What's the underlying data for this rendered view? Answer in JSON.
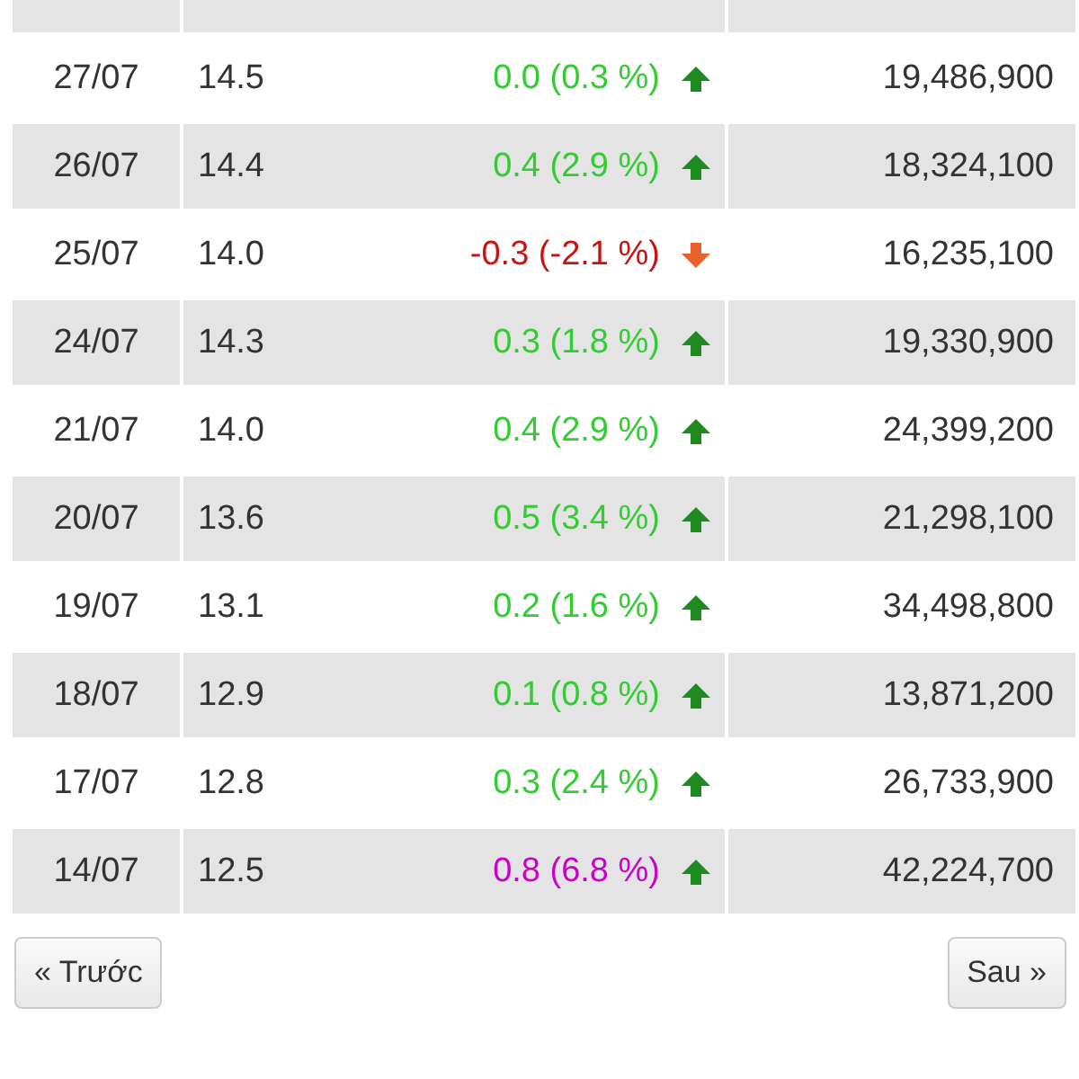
{
  "rows": [
    {
      "date": "27/07",
      "close": "14.5",
      "change": "0.0 (0.3 %)",
      "kind": "up",
      "volume": "19,486,900"
    },
    {
      "date": "26/07",
      "close": "14.4",
      "change": "0.4 (2.9 %)",
      "kind": "up",
      "volume": "18,324,100"
    },
    {
      "date": "25/07",
      "close": "14.0",
      "change": "-0.3 (-2.1 %)",
      "kind": "down",
      "volume": "16,235,100"
    },
    {
      "date": "24/07",
      "close": "14.3",
      "change": "0.3 (1.8 %)",
      "kind": "up",
      "volume": "19,330,900"
    },
    {
      "date": "21/07",
      "close": "14.0",
      "change": "0.4 (2.9 %)",
      "kind": "up",
      "volume": "24,399,200"
    },
    {
      "date": "20/07",
      "close": "13.6",
      "change": "0.5 (3.4 %)",
      "kind": "up",
      "volume": "21,298,100"
    },
    {
      "date": "19/07",
      "close": "13.1",
      "change": "0.2 (1.6 %)",
      "kind": "up",
      "volume": "34,498,800"
    },
    {
      "date": "18/07",
      "close": "12.9",
      "change": "0.1 (0.8 %)",
      "kind": "up",
      "volume": "13,871,200"
    },
    {
      "date": "17/07",
      "close": "12.8",
      "change": "0.3 (2.4 %)",
      "kind": "up",
      "volume": "26,733,900"
    },
    {
      "date": "14/07",
      "close": "12.5",
      "change": "0.8 (6.8 %)",
      "kind": "ceiling",
      "volume": "42,224,700"
    }
  ],
  "pager": {
    "previous": "« Trước",
    "next": "Sau »"
  }
}
